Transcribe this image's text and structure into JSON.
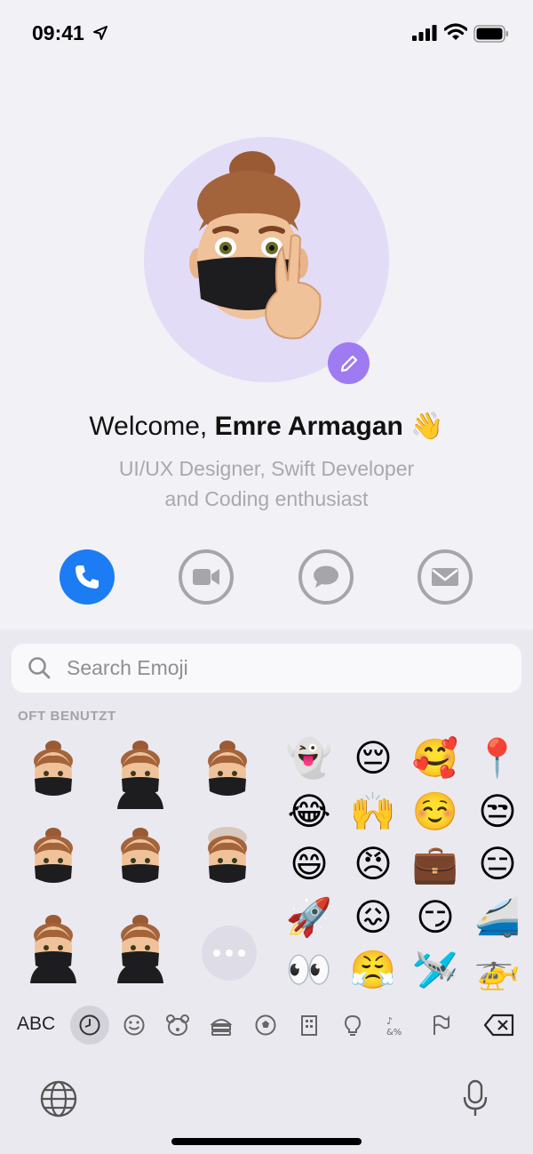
{
  "status_bar": {
    "time": "09:41"
  },
  "profile": {
    "welcome_prefix": "Welcome,",
    "name": "Emre Armagan",
    "wave": "👋",
    "bio_line1": "UI/UX Designer, Swift Developer",
    "bio_line2": "and Coding enthusiast"
  },
  "actions": [
    "phone",
    "video",
    "message",
    "mail"
  ],
  "colors": {
    "accent": "#1b7cf3",
    "avatar_bg": "#e3dcf7",
    "edit_badge": "#9e7bf0"
  },
  "keyboard": {
    "search_placeholder": "Search Emoji",
    "section_label": "OFT BENUTZT",
    "memojis": [
      "thumbs-up",
      "hand-over-mouth",
      "grawlix-mask",
      "wink",
      "peace-sign",
      "mind-blown",
      "pointing",
      "meditating"
    ],
    "emojis": [
      [
        "👻",
        "😔",
        "🥰",
        "📍"
      ],
      [
        "😂",
        "🙌",
        "☺️",
        "😒"
      ],
      [
        "😄",
        "😠",
        "💼",
        "😑"
      ],
      [
        "🚀",
        "😖",
        "😏",
        "🚄"
      ],
      [
        "👀",
        "😤",
        "🛩️",
        "🚁"
      ]
    ],
    "abc_label": "ABC",
    "categories": [
      "recent",
      "smileys",
      "animals",
      "food",
      "activity",
      "travel",
      "objects",
      "symbols",
      "flags"
    ]
  }
}
